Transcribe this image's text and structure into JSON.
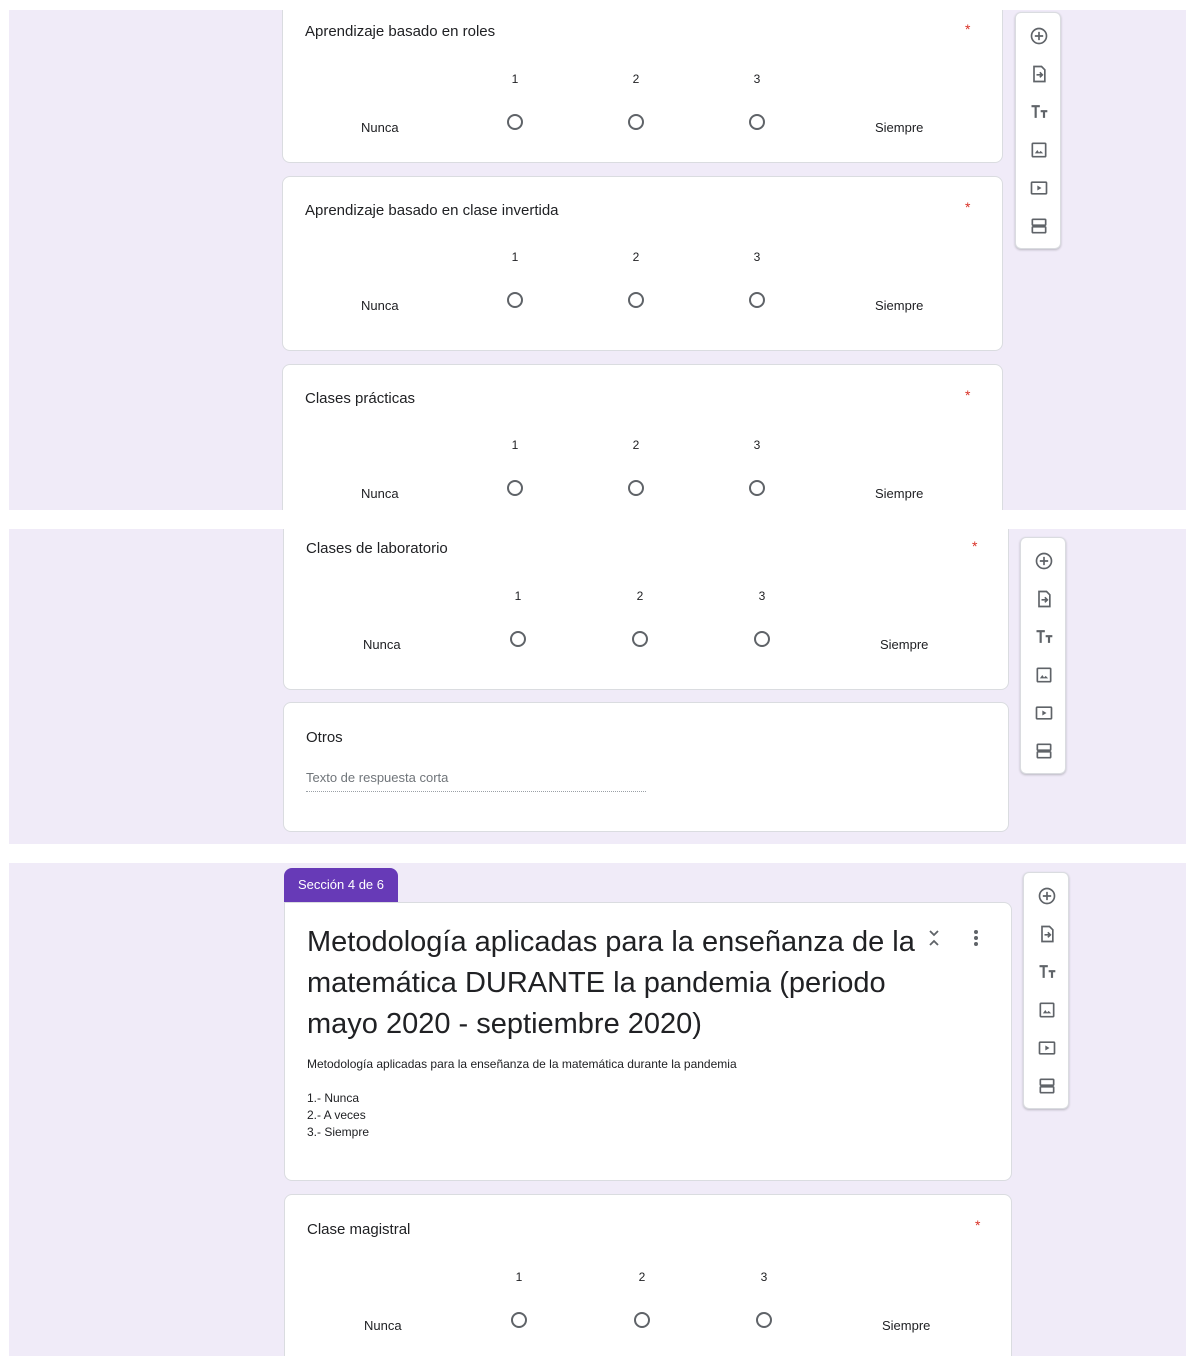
{
  "scale": {
    "numbers": [
      "1",
      "2",
      "3"
    ],
    "low_label": "Nunca",
    "high_label": "Siempre",
    "required_mark": "*"
  },
  "panel1": {
    "questions": [
      {
        "title": "Aprendizaje basado en roles"
      },
      {
        "title": "Aprendizaje basado en clase invertida"
      },
      {
        "title": "Clases prácticas"
      }
    ]
  },
  "panel2": {
    "questions": [
      {
        "title": "Clases de laboratorio"
      }
    ],
    "short_question": {
      "title": "Otros",
      "placeholder": "Texto de respuesta corta"
    }
  },
  "panel3": {
    "section_badge": "Sección 4 de 6",
    "section_title": "Metodología aplicadas para la enseñanza de la matemática DURANTE la pandemia (periodo  mayo 2020 - septiembre 2020)",
    "section_description": "Metodología aplicadas para la enseñanza de la matemática durante la pandemia",
    "legend": [
      "1.- Nunca",
      "2.- A veces",
      "3.- Siempre"
    ],
    "questions": [
      {
        "title": "Clase magistral"
      }
    ]
  },
  "toolbar": {
    "icons": [
      "add-question-icon",
      "import-questions-icon",
      "add-title-icon",
      "add-image-icon",
      "add-video-icon",
      "add-section-icon"
    ]
  },
  "colors": {
    "background": "#f0ebf8",
    "accent": "#673ab7",
    "required": "#d93025"
  }
}
